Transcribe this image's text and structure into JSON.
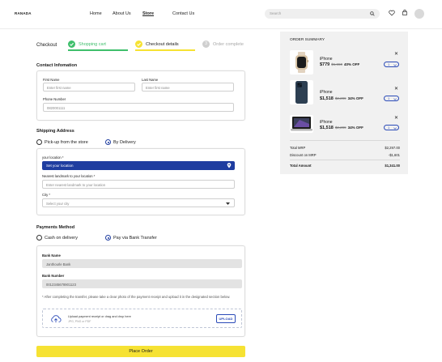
{
  "header": {
    "logo": "RANADA",
    "nav": [
      "Home",
      "About Us",
      "Store",
      "Contact Us"
    ],
    "active_nav": "Store",
    "search_placeholder": "Search",
    "icons": [
      "search-icon",
      "heart-icon",
      "cart-icon",
      "avatar"
    ]
  },
  "progress": {
    "label": "Checkout",
    "steps": [
      {
        "label": "Shopping cart",
        "state": "done"
      },
      {
        "label": "Checkout details",
        "state": "current"
      },
      {
        "label": "Order complete",
        "state": "pending",
        "number": "3"
      }
    ]
  },
  "contact": {
    "title": "Contact Infomation",
    "first_name_label": "First Name",
    "first_name_placeholder": "Enter first name",
    "last_name_label": "Last Name",
    "last_name_placeholder": "Enter first name",
    "phone_label": "Phone Number",
    "phone_value": "0820001111"
  },
  "shipping": {
    "title": "Shipping Address",
    "option_pickup": "Pick-up from the store",
    "option_delivery": "By Delivery",
    "selected": "By Delivery",
    "location_label": "your location *",
    "location_value": "Set your location",
    "landmark_label": "Nearest landmark to your location *",
    "landmark_placeholder": "Enter nearest landmark to your location",
    "city_label": "City *",
    "city_placeholder": "Select your city"
  },
  "payment": {
    "title": "Payments Method",
    "option_cod": "Cash on delivery",
    "option_bank": "Pay via Bank Transfer",
    "selected": "Pay via Bank Transfer",
    "bank_name_label": "Bank Name",
    "bank_name_value": "Janthourle Bank",
    "bank_number_label": "Bank Number",
    "bank_number_value": "0012345678901123",
    "note": "* After completing the transfer, please take a clear photo of the payment receipt and upload it in the designated section below.",
    "upload_text": "Upload payment receipt or drag and drop here",
    "upload_formats": "JPG, PNG or PDF",
    "upload_button": "UPLOAD"
  },
  "place_order": "Place Order",
  "summary": {
    "title": "ORDER SUMMARY",
    "items": [
      {
        "name": "iPhone",
        "price": "$779",
        "mrp": "$1,650",
        "off": "40% OFF",
        "qty": "1",
        "image": "watch"
      },
      {
        "name": "iPhone",
        "price": "$1,518",
        "mrp": "$2,299",
        "off": "34% OFF",
        "qty": "1",
        "image": "phone"
      },
      {
        "name": "iPhone",
        "price": "$1,518",
        "mrp": "$2,299",
        "off": "34% OFF",
        "qty": "1",
        "image": "laptop"
      }
    ],
    "total_mrp_label": "Total MRP",
    "total_mrp_value": "$2,297.00",
    "discount_label": "Discount on MRP",
    "discount_value": "-$1,601",
    "total_label": "Total Amount",
    "total_value": "$1,341.00"
  },
  "colors": {
    "accent_blue": "#1f3da0",
    "yellow": "#f6e233",
    "green": "#3fbf6c"
  }
}
